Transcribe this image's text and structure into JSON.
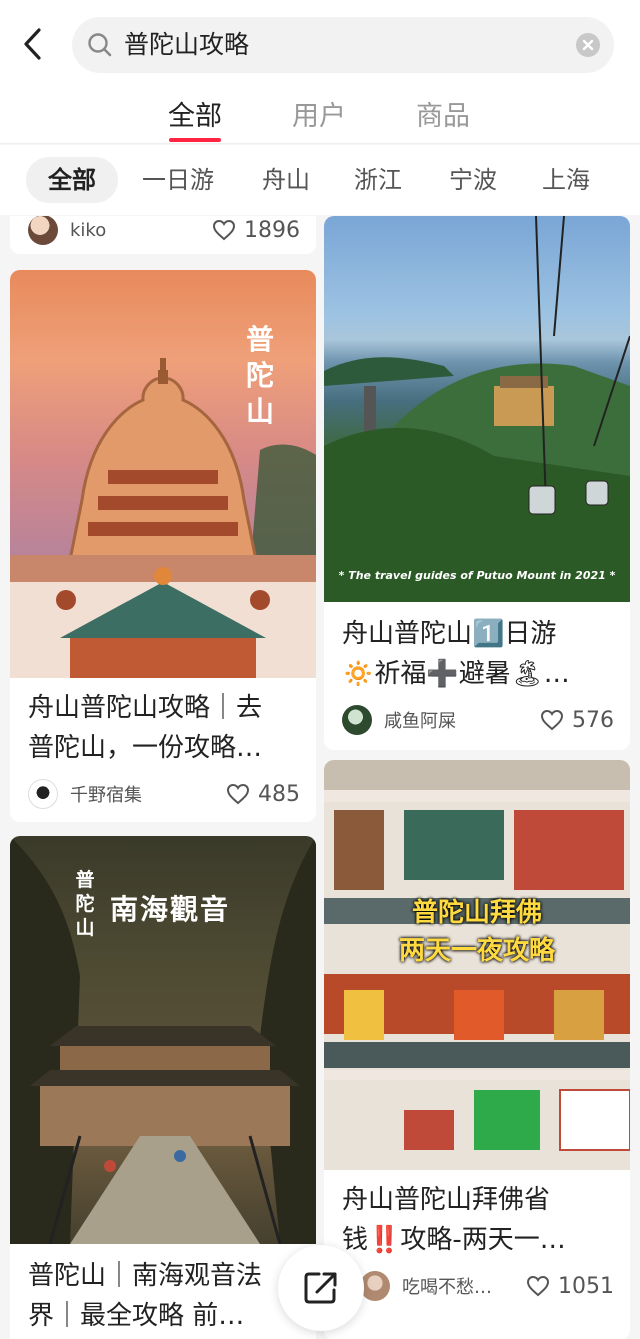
{
  "search": {
    "query": "普陀山攻略"
  },
  "tabs": [
    {
      "label": "全部"
    },
    {
      "label": "用户"
    },
    {
      "label": "商品"
    }
  ],
  "chips": [
    {
      "label": "全部"
    },
    {
      "label": "一日游"
    },
    {
      "label": "舟山"
    },
    {
      "label": "浙江"
    },
    {
      "label": "宁波"
    },
    {
      "label": "上海"
    }
  ],
  "cards": [
    {
      "author": "kiko",
      "likes": "1896"
    },
    {
      "image_text": "普陀山",
      "title_line1": "舟山普陀山攻略｜去",
      "title_line2": "普陀山，一份攻略…",
      "author": "千野宿集",
      "likes": "485"
    },
    {
      "image_caption": "* The travel guides of Putuo Mount in 2021 *",
      "title_line1": "舟山普陀山1️⃣日游",
      "title_line2": "🔅祈福➕避暑🏝…",
      "author": "咸鱼阿屎",
      "likes": "576"
    },
    {
      "image_text_vertical": "普陀山",
      "image_text": "南海觀音",
      "title_line1": "普陀山｜南海观音法",
      "title_line2": "界｜最全攻略 前…"
    },
    {
      "image_text_line1": "普陀山拜佛",
      "image_text_line2": "两天一夜攻略",
      "title_line1": "舟山普陀山拜佛省",
      "title_line2": "钱‼️攻略-两天一…",
      "author": "吃喝不愁…",
      "likes": "1051"
    }
  ],
  "colors": {
    "accent": "#ff2442"
  }
}
